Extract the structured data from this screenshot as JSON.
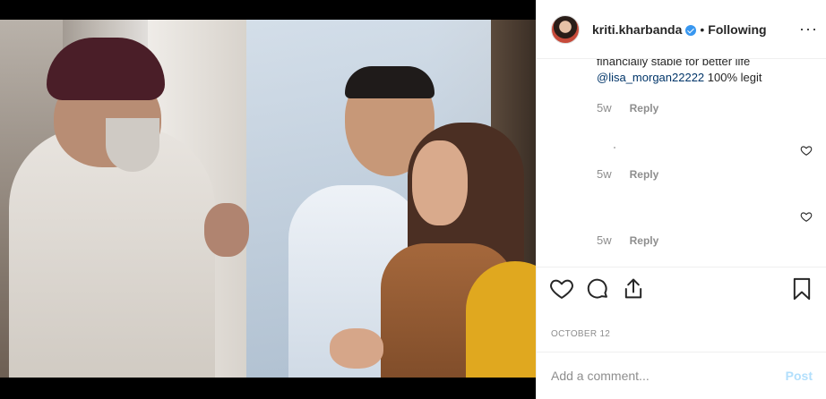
{
  "photo": {
    "alt_icon": "post-image"
  },
  "header": {
    "username": "kriti.kharbanda",
    "separator": "•",
    "follow_status": "Following",
    "more_icon": "more-options-icon"
  },
  "comments": [
    {
      "text_partial": "financially stable for better life",
      "mention": "@lisa_morgan22222",
      "suffix": " 100% legit",
      "time": "5w",
      "reply": "Reply"
    },
    {
      "text": "",
      "time": "5w",
      "reply": "Reply"
    },
    {
      "text": "",
      "time": "5w",
      "reply": "Reply"
    }
  ],
  "actions": {
    "like_icon": "heart-icon",
    "comment_icon": "comment-icon",
    "share_icon": "share-icon",
    "save_icon": "bookmark-icon"
  },
  "date": "OCTOBER 12",
  "add_comment": {
    "placeholder": "Add a comment...",
    "post_label": "Post"
  },
  "colors": {
    "mention": "#003569",
    "muted": "#8e8e8e",
    "verified": "#3897f0",
    "post_disabled": "#b2dffc"
  }
}
